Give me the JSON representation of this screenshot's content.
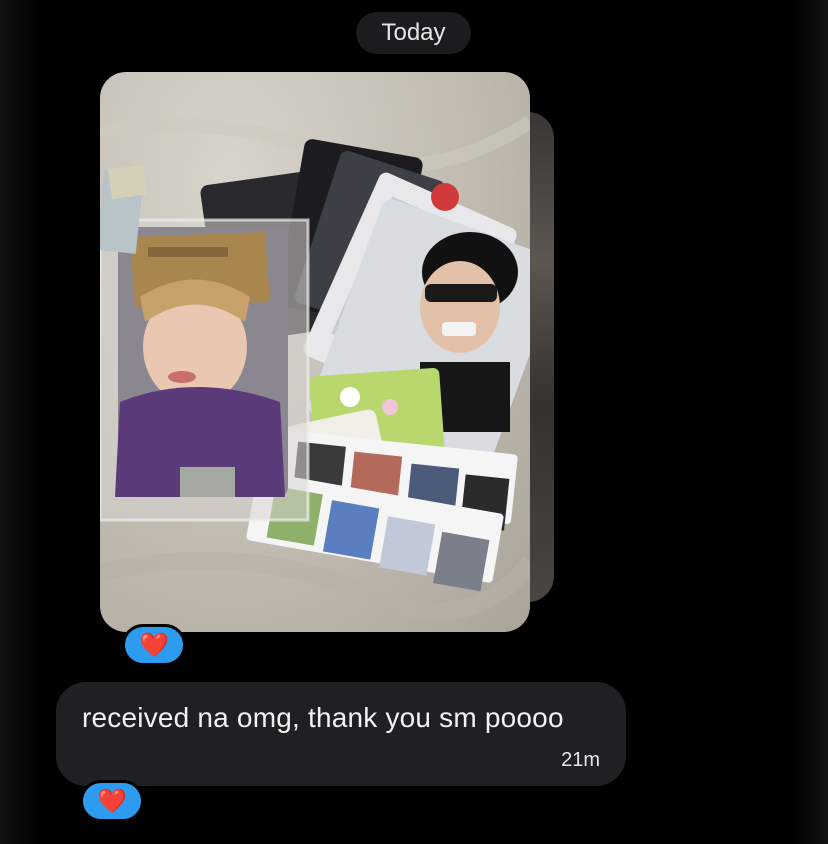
{
  "header": {
    "date_label": "Today"
  },
  "messages": [
    {
      "type": "image",
      "alt": "",
      "reaction": "❤️"
    },
    {
      "type": "text",
      "text": "received na omg, thank you sm poooo",
      "time": "21m",
      "reaction": "❤️"
    }
  ],
  "colors": {
    "reaction_bg": "#2d9bf0",
    "bubble_bg": "#1f2022",
    "heart": "#e0243a"
  },
  "icons": {
    "reaction": "heart-icon"
  }
}
